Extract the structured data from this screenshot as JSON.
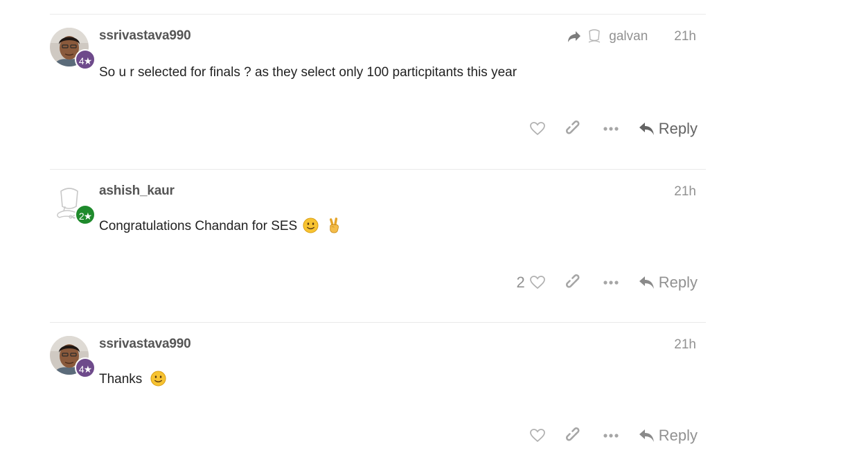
{
  "posts": [
    {
      "username": "ssrivastava990",
      "flair": "4★",
      "flair_color": "#6e4a8b",
      "reply_to": "galvan",
      "date": "21h",
      "text": "So u r selected for finals ? as they select only 100 particpitants this year",
      "likes": "",
      "reply_label": "Reply"
    },
    {
      "username": "ashish_kaur",
      "flair": "2★",
      "flair_color": "#1f8a2c",
      "date": "21h",
      "text": "Congratulations Chandan for SES",
      "emojis": [
        "slightly-smiling-face",
        "victory-hand"
      ],
      "likes": "2",
      "reply_label": "Reply"
    },
    {
      "username": "ssrivastava990",
      "flair": "4★",
      "flair_color": "#6e4a8b",
      "date": "21h",
      "text": "Thanks",
      "emojis": [
        "slightly-smiling-face"
      ],
      "likes": "",
      "reply_label": "Reply"
    }
  ],
  "colors": {
    "muted": "#919191",
    "username": "#555555",
    "divider": "#e9e9e9"
  }
}
